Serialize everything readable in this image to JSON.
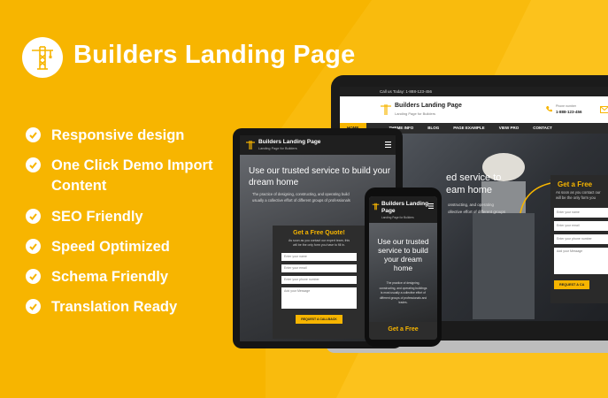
{
  "brand": {
    "title": "Builders Landing Page",
    "logo_icon": "crane-tower-icon",
    "color": "#f7b500"
  },
  "features": [
    {
      "line1": "Responsive design",
      "line2": ""
    },
    {
      "line1": "One Click Demo Import",
      "line2": "Content"
    },
    {
      "line1": "SEO Friendly",
      "line2": ""
    },
    {
      "line1": "Speed Optimized",
      "line2": ""
    },
    {
      "line1": "Schema Friendly",
      "line2": ""
    },
    {
      "line1": "Translation Ready",
      "line2": ""
    }
  ],
  "laptop": {
    "topbar_text": "Call us Today: 1-888-123-456",
    "site_title": "Builders Landing Page",
    "site_tagline": "Landing Page for Builders",
    "phone_label": "Phone number",
    "phone_number": "1-888-123-456",
    "nav": [
      "HOME",
      "THEME INFO",
      "BLOG",
      "PAGE EXAMPLE",
      "VIEW PRO",
      "CONTACT"
    ],
    "hero_title_line1": "ed service to",
    "hero_title_line2": "eam home",
    "hero_text_line1": "onstructing, and operating",
    "hero_text_line2": "ollective effort of different groups",
    "form_title": "Get a Free",
    "form_sub_line1": "As soon as you contact our",
    "form_sub_line2": "will be the only form you",
    "inputs": [
      "Enter your name",
      "Enter your email",
      "Enter your phone number"
    ],
    "textarea": "Add your Message",
    "button": "REQUEST A CA"
  },
  "tablet": {
    "site_title": "Builders Landing Page",
    "site_tagline": "Landing Page for Builders",
    "hero_title_line1": "Use our trusted service to build your",
    "hero_title_line2": "dream home",
    "hero_text_line1": "The practice of designing, constructing, and operating build",
    "hero_text_line2": "usually a collective effort of different groups of professionals",
    "form_title": "Get a Free Quote!",
    "form_sub_line1": "As soon as you contact our expert team, this",
    "form_sub_line2": "will be the only form you have to fill in.",
    "inputs": [
      "Enter your name",
      "Enter your email",
      "Enter your phone number"
    ],
    "textarea": "Add your Message",
    "button": "REQUEST A CALLBACK"
  },
  "phone": {
    "site_title_line1": "Builders Landing",
    "site_title_line2": "Page",
    "site_tagline": "Landing Page for Builders",
    "hero_title": [
      "Use our trusted",
      "service to build",
      "your dream",
      "home"
    ],
    "hero_text": [
      "The practice of designing,",
      "constructing, and operating buildings",
      "is most usually a collective effort of",
      "different groups of professionals and",
      "trades."
    ],
    "form_title": "Get a Free"
  }
}
